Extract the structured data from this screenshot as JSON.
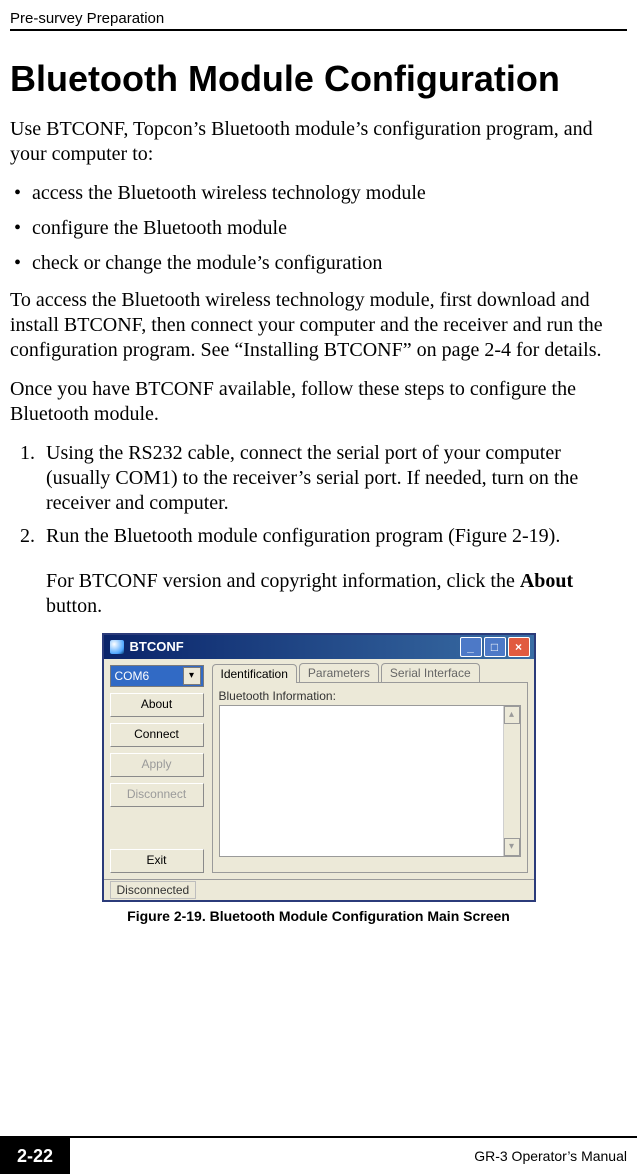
{
  "header": {
    "section": "Pre-survey Preparation"
  },
  "title": "Bluetooth Module Configuration",
  "intro": "Use BTCONF, Topcon’s Bluetooth module’s configuration program, and your computer to:",
  "bullets": [
    "access the Bluetooth wireless technology module",
    "configure the Bluetooth module",
    "check or change the module’s configuration"
  ],
  "para2": "To access the Bluetooth wireless technology module, first download and install BTCONF, then connect your computer and the receiver and run the configuration program. See “Installing BTCONF” on page 2-4 for details.",
  "para3": "Once you have BTCONF available, follow these steps to configure the Bluetooth module.",
  "steps": [
    "Using the RS232 cable, connect the serial port of your computer (usually COM1) to the receiver’s serial port. If needed, turn on the receiver and computer.",
    "Run the Bluetooth module configuration program (Figure 2-19)."
  ],
  "step2_note_prefix": "For BTCONF version and copyright information, click the ",
  "step2_note_bold": "About",
  "step2_note_suffix": " button.",
  "window": {
    "title": "BTCONF",
    "combo_selected": "COM6",
    "buttons": {
      "about": "About",
      "connect": "Connect",
      "apply": "Apply",
      "disconnect": "Disconnect",
      "exit": "Exit"
    },
    "tabs": [
      "Identification",
      "Parameters",
      "Serial Interface"
    ],
    "group_label": "Bluetooth Information:",
    "status": "Disconnected"
  },
  "figure_caption": "Figure 2-19. Bluetooth Module Configuration Main Screen",
  "footer": {
    "page": "2-22",
    "manual": "GR-3 Operator’s Manual"
  }
}
